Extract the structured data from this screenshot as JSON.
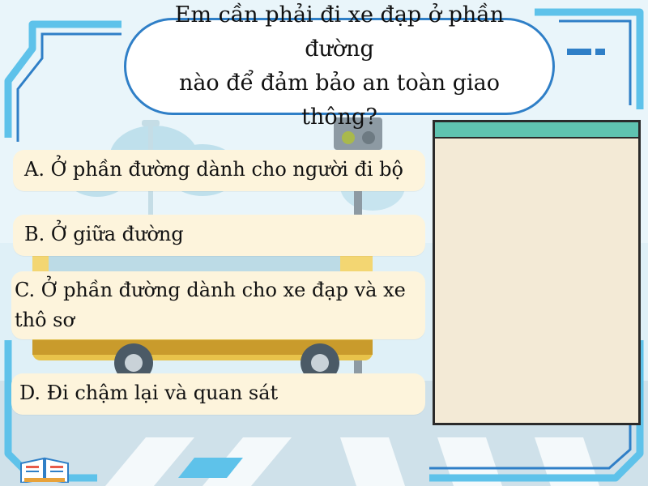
{
  "question": {
    "text": "Em cần phải đi xe đạp ở phần đường\nnào để đảm bảo an toàn giao thông?"
  },
  "answers": [
    {
      "label": "A. Ở phần đường dành cho người đi bộ"
    },
    {
      "label": "B. Ở giữa đường"
    },
    {
      "label": "C. Ở phần đường dành cho xe đạp và xe\nthô sơ"
    },
    {
      "label": "D. Đi chậm lại và quan sát"
    }
  ],
  "icons": {
    "corner": "book-icon"
  },
  "colors": {
    "frame": "#5ec2ea",
    "bubble_border": "#2f7fc7",
    "answer_bg": "#fdf4dc",
    "panel_bg": "#f3ead6",
    "panel_header": "#5fc3b0"
  }
}
